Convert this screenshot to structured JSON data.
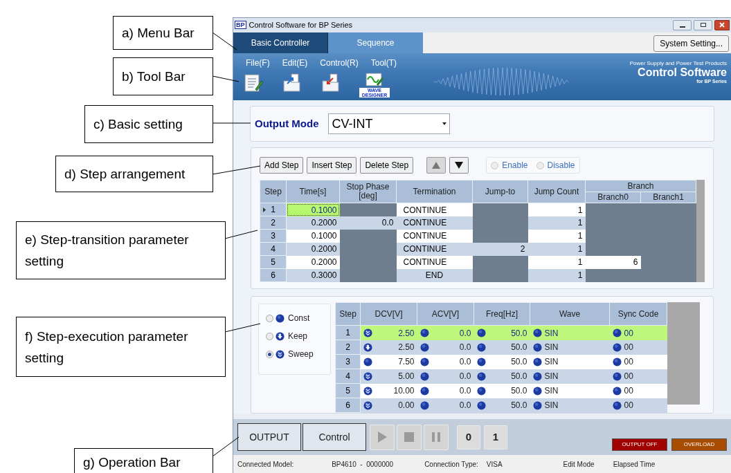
{
  "window": {
    "logo": "BP",
    "title": "Control Software for BP Series"
  },
  "tabs": [
    {
      "label": "Basic Controller",
      "selected": false
    },
    {
      "label": "Sequence",
      "selected": true
    }
  ],
  "system_button": "System Setting...",
  "menu": [
    "File(F)",
    "Edit(E)",
    "Control(R)",
    "Tool(T)"
  ],
  "toolbar": [
    {
      "kind": "new"
    },
    {
      "kind": "open"
    },
    {
      "kind": "save"
    },
    {
      "kind": "wave",
      "label": "WAVE DESIGNER"
    }
  ],
  "banner": {
    "tagline": "Power Supply and Power Test Products",
    "title": "Control Software",
    "subtitle": "for BP Series"
  },
  "basic_setting": {
    "label": "Output Mode",
    "value": "CV-INT"
  },
  "step_buttons": [
    "Add Step",
    "Insert Step",
    "Delete Step"
  ],
  "branch_radios": [
    {
      "label": "Enable",
      "selected": false
    },
    {
      "label": "Disable",
      "selected": false
    }
  ],
  "step_table": {
    "columns": [
      "Step",
      "Time[s]",
      "Stop Phase [deg]",
      "Termination",
      "Jump-to",
      "Jump Count"
    ],
    "group": "Branch",
    "group_columns": [
      "Branch0",
      "Branch1"
    ],
    "rows": [
      {
        "step": "1",
        "selected": true,
        "time": "0.1000",
        "termination": "CONTINUE",
        "jump_count": "1"
      },
      {
        "step": "2",
        "selected": false,
        "time": "0.2000",
        "stop_phase": "0.0",
        "termination": "CONTINUE",
        "jump_count": "1"
      },
      {
        "step": "3",
        "selected": false,
        "time": "0.1000",
        "termination": "CONTINUE",
        "jump_count": "1"
      },
      {
        "step": "4",
        "selected": false,
        "time": "0.2000",
        "termination": "CONTINUE",
        "jump_to": "2",
        "jump_count": "1"
      },
      {
        "step": "5",
        "selected": false,
        "time": "0.2000",
        "termination": "CONTINUE",
        "jump_count": "1",
        "branch0": "6"
      },
      {
        "step": "6",
        "selected": false,
        "time": "0.3000",
        "termination": "END",
        "jump_count": "1"
      }
    ]
  },
  "modes": [
    {
      "label": "Const",
      "kind": "const",
      "selected": false
    },
    {
      "label": "Keep",
      "kind": "keep",
      "selected": false
    },
    {
      "label": "Sweep",
      "kind": "sweep",
      "selected": true
    }
  ],
  "exec_table": {
    "columns": [
      "Step",
      "DCV[V]",
      "ACV[V]",
      "Freq[Hz]",
      "Wave",
      "Sync Code"
    ],
    "rows": [
      {
        "step": "1",
        "selected": true,
        "dcv": {
          "kind": "sweep",
          "value": "2.50"
        },
        "acv": {
          "kind": "const",
          "value": "0.0"
        },
        "freq": {
          "kind": "const",
          "value": "50.0"
        },
        "wave": {
          "kind": "const",
          "value": "SIN"
        },
        "sync": {
          "kind": "const",
          "value": "00"
        }
      },
      {
        "step": "2",
        "selected": false,
        "dcv": {
          "kind": "keep",
          "value": "2.50"
        },
        "acv": {
          "kind": "const",
          "value": "0.0"
        },
        "freq": {
          "kind": "const",
          "value": "50.0"
        },
        "wave": {
          "kind": "const",
          "value": "SIN"
        },
        "sync": {
          "kind": "const",
          "value": "00"
        }
      },
      {
        "step": "3",
        "selected": false,
        "dcv": {
          "kind": "const",
          "value": "7.50"
        },
        "acv": {
          "kind": "const",
          "value": "0.0"
        },
        "freq": {
          "kind": "const",
          "value": "50.0"
        },
        "wave": {
          "kind": "const",
          "value": "SIN"
        },
        "sync": {
          "kind": "const",
          "value": "00"
        }
      },
      {
        "step": "4",
        "selected": false,
        "dcv": {
          "kind": "sweep",
          "value": "5.00"
        },
        "acv": {
          "kind": "const",
          "value": "0.0"
        },
        "freq": {
          "kind": "const",
          "value": "50.0"
        },
        "wave": {
          "kind": "const",
          "value": "SIN"
        },
        "sync": {
          "kind": "const",
          "value": "00"
        }
      },
      {
        "step": "5",
        "selected": false,
        "dcv": {
          "kind": "sweep",
          "value": "10.00"
        },
        "acv": {
          "kind": "const",
          "value": "0.0"
        },
        "freq": {
          "kind": "const",
          "value": "50.0"
        },
        "wave": {
          "kind": "const",
          "value": "SIN"
        },
        "sync": {
          "kind": "const",
          "value": "00"
        }
      },
      {
        "step": "6",
        "selected": false,
        "dcv": {
          "kind": "sweep",
          "value": "0.00"
        },
        "acv": {
          "kind": "const",
          "value": "0.0"
        },
        "freq": {
          "kind": "const",
          "value": "50.0"
        },
        "wave": {
          "kind": "const",
          "value": "SIN"
        },
        "sync": {
          "kind": "const",
          "value": "00"
        }
      }
    ]
  },
  "operation": {
    "buttons": [
      "OUTPUT",
      "Control"
    ],
    "playback": [
      {
        "kind": "play"
      },
      {
        "kind": "stop"
      },
      {
        "kind": "pause"
      }
    ],
    "memory": [
      "0",
      "1"
    ],
    "indicators": [
      {
        "label": "OUTPUT OFF",
        "color": "#a00000"
      },
      {
        "label": "OVERLOAD",
        "color": "#a84c00"
      }
    ]
  },
  "status_bar": [
    "Connected Model:",
    "BP4610  -  0000000",
    "Connection Type:",
    "VISA",
    "Edit Mode",
    "Elapsed Time"
  ],
  "callouts": [
    "a) Menu Bar",
    "b) Tool Bar",
    "c) Basic setting",
    "d) Step arrangement",
    "e) Step-transition parameter setting",
    "f) Step-execution parameter setting",
    "g) Operation Bar"
  ]
}
